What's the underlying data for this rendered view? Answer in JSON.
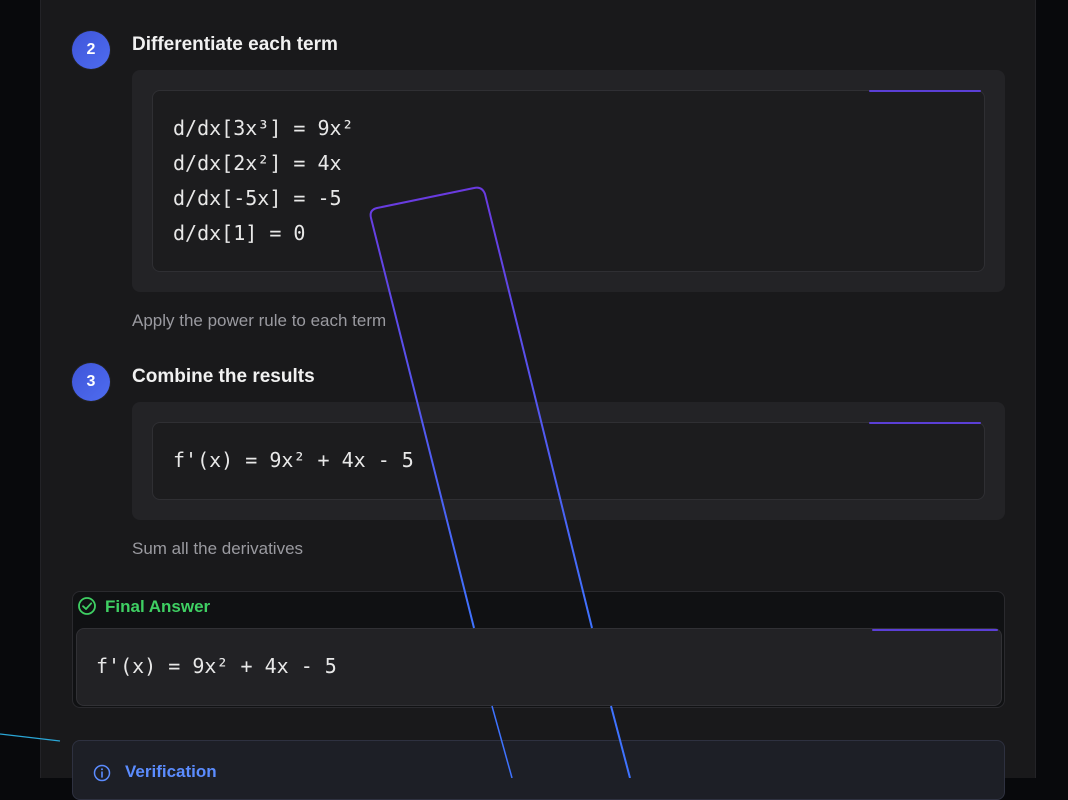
{
  "steps": [
    {
      "number": "2",
      "title": "Differentiate each term",
      "code": [
        "d/dx[3x³] = 9x²",
        "d/dx[2x²] = 4x",
        "d/dx[-5x] = -5",
        "d/dx[1] = 0"
      ],
      "caption": "Apply the power rule to each term"
    },
    {
      "number": "3",
      "title": "Combine the results",
      "code": [
        "f'(x) = 9x² + 4x - 5"
      ],
      "caption": "Sum all the derivatives"
    }
  ],
  "final_answer": {
    "label": "Final Answer",
    "value": "f'(x) = 9x² + 4x - 5",
    "icon": "check-circle-icon",
    "color": "#3fcf63"
  },
  "verification": {
    "label": "Verification",
    "icon": "info-icon",
    "color": "#5b8cff"
  },
  "colors": {
    "badge": "#4a63e8",
    "accent": "#5b3fd6"
  }
}
